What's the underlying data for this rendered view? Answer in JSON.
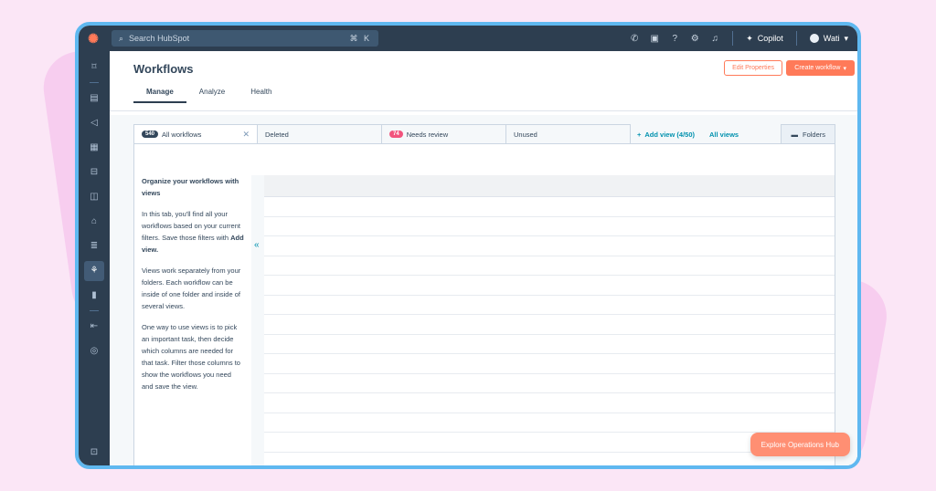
{
  "topbar": {
    "search_placeholder": "Search HubSpot",
    "search_shortcut": "⌘ K",
    "copilot_label": "Copilot",
    "account_name": "Wati"
  },
  "header": {
    "title": "Workflows",
    "edit_properties": "Edit Properties",
    "create_workflow": "Create workflow",
    "tabs": [
      {
        "label": "Manage",
        "active": true
      },
      {
        "label": "Analyze",
        "active": false
      },
      {
        "label": "Health",
        "active": false
      }
    ]
  },
  "views": {
    "all_workflows": {
      "label": "All workflows",
      "count": "540"
    },
    "deleted": {
      "label": "Deleted"
    },
    "needs_review": {
      "label": "Needs review",
      "count": "74"
    },
    "unused": {
      "label": "Unused"
    },
    "add_view": "Add view (4/50)",
    "all_views": "All views",
    "folders": "Folders"
  },
  "info_panel": {
    "title": "Organize your workflows with views",
    "para1_prefix": "In this tab, you'll find all your workflows based on your current filters. Save those filters with ",
    "para1_bold": "Add view.",
    "para2": "Views work separately from your folders. Each workflow can be inside of one folder and inside of several views.",
    "para3": "One way to use views is to pick an important task, then decide which columns are needed for that task. Filter those columns to show the workflows you need and save the view."
  },
  "explore_button": "Explore Operations Hub",
  "colors": {
    "accent": "#ff7a59",
    "nav_bg": "#2d3e50",
    "link": "#0091ae",
    "frame_border": "#5fb8f0"
  }
}
